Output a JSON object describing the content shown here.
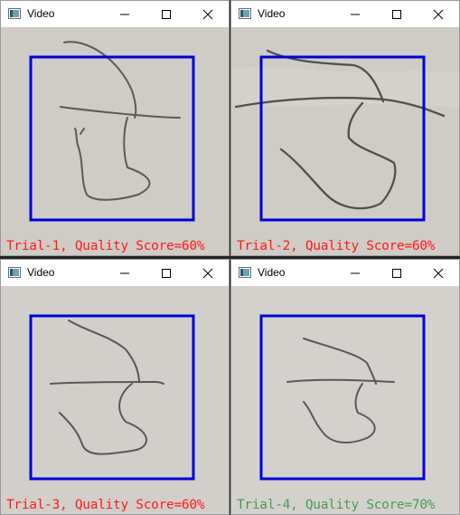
{
  "windows": [
    {
      "title": "Video",
      "caption": "Trial-1, Quality Score=60%",
      "caption_color": "#ff1a1a",
      "box_color": "#0000d8"
    },
    {
      "title": "Video",
      "caption": "Trial-2, Quality Score=60%",
      "caption_color": "#ff1a1a",
      "box_color": "#0000d8"
    },
    {
      "title": "Video",
      "caption": "Trial-3, Quality Score=60%",
      "caption_color": "#ff1a1a",
      "box_color": "#0000d8"
    },
    {
      "title": "Video",
      "caption": "Trial-4, Quality Score=70%",
      "caption_color": "#4a9a55",
      "box_color": "#0000d8"
    }
  ],
  "icons": {
    "app": "video-window-icon",
    "minimize": "minimize-icon",
    "maximize": "maximize-icon",
    "close": "close-icon"
  }
}
